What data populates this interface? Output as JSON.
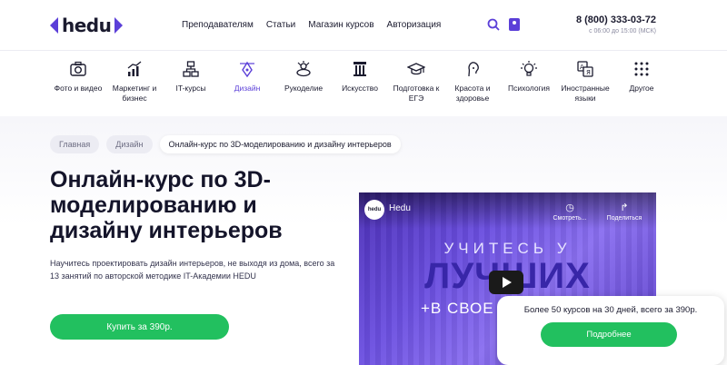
{
  "header": {
    "logo_text": "hedu",
    "nav": [
      "Преподавателям",
      "Статьи",
      "Магазин курсов",
      "Авторизация"
    ],
    "phone": "8 (800) 333-03-72",
    "hours": "с 06:00 до 15:00 (МСК)",
    "accent_color": "#5b3fd8"
  },
  "categories": [
    {
      "label": "Фото и видео",
      "icon": "camera-icon"
    },
    {
      "label": "Маркетинг и бизнес",
      "icon": "growth-chart-icon"
    },
    {
      "label": "IT-курсы",
      "icon": "network-icon"
    },
    {
      "label": "Дизайн",
      "icon": "pen-tool-icon",
      "active": true
    },
    {
      "label": "Рукоделие",
      "icon": "craft-icon"
    },
    {
      "label": "Искусство",
      "icon": "column-icon"
    },
    {
      "label": "Подготовка к ЕГЭ",
      "icon": "graduation-cap-icon"
    },
    {
      "label": "Красота и здоровье",
      "icon": "face-icon"
    },
    {
      "label": "Психология",
      "icon": "lightbulb-icon"
    },
    {
      "label": "Иностранные языки",
      "icon": "translate-icon"
    },
    {
      "label": "Другое",
      "icon": "dots-grid-icon"
    }
  ],
  "breadcrumbs": [
    "Главная",
    "Дизайн",
    "Онлайн-курс по 3D-моделированию и дизайну интерьеров"
  ],
  "hero": {
    "title": "Онлайн-курс по 3D-моделированию и дизайну интерьеров",
    "description": "Научитесь проектировать дизайн интерьеров, не выходя из дома, всего за 13 занятий по авторской методике IT-Академии HEDU",
    "buy_label": "Купить за 390р.",
    "button_color": "#22c05f"
  },
  "video": {
    "channel": "hedu",
    "title": "Hedu",
    "watch_later": "Смотреть...",
    "share": "Поделиться",
    "line1": "УЧИТЕСЬ У",
    "line2": "ЛУЧШИХ",
    "line3": "+В СВОЕ"
  },
  "promo": {
    "text": "Более 50 курсов на 30 дней, всего за 390р.",
    "button": "Подробнее"
  }
}
